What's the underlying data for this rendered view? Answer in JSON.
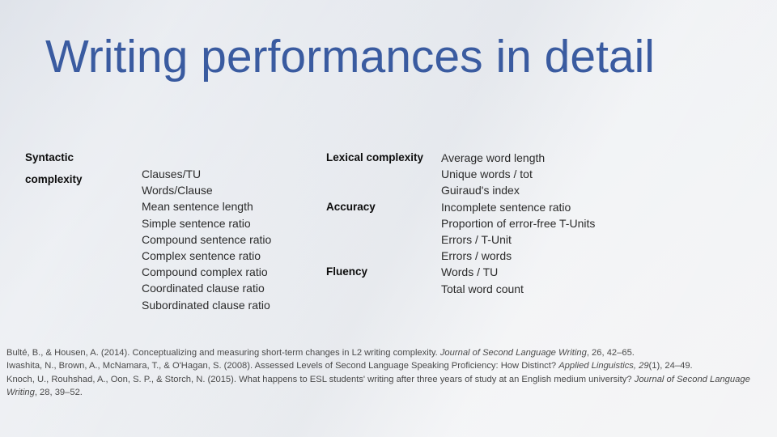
{
  "slide": {
    "title": "Writing performances in detail",
    "title_color": "#3a5ba0",
    "background_color": "#eef0f3"
  },
  "table": {
    "left": {
      "category_line1": "Syntactic",
      "category_line2": "complexity",
      "items": [
        "Clauses/TU",
        "Words/Clause",
        "Mean sentence length",
        "Simple sentence ratio",
        "Compound sentence ratio",
        "Complex sentence ratio",
        "Compound complex ratio",
        "Coordinated clause ratio",
        "Subordinated clause ratio"
      ]
    },
    "right": {
      "categories": [
        {
          "label": "Lexical complexity",
          "row": 0
        },
        {
          "label": "Accuracy",
          "row": 3
        },
        {
          "label": "Fluency",
          "row": 7
        }
      ],
      "items": [
        "Average word length",
        "Unique words / tot",
        "Guiraud's index",
        "Incomplete sentence ratio",
        "Proportion of error-free T-Units",
        "Errors / T-Unit",
        "Errors / words",
        "Words / TU",
        "Total word count"
      ]
    }
  },
  "references": [
    {
      "parts": [
        {
          "text": "Bulté, B., & Housen, A. (2014). Conceptualizing and measuring short-term changes in L2 writing complexity. ",
          "style": "normal"
        },
        {
          "text": "Journal of Second Language Writing",
          "style": "italic"
        },
        {
          "text": ", 26, 42–65.",
          "style": "normal"
        }
      ]
    },
    {
      "parts": [
        {
          "text": "Iwashita, N., Brown, A., McNamara, T., & O'Hagan, S. (2008). Assessed Levels of Second Language Speaking Proficiency: How Distinct? ",
          "style": "normal"
        },
        {
          "text": "Applied Linguistics, 29",
          "style": "italic"
        },
        {
          "text": "(1), 24–49.",
          "style": "normal"
        }
      ]
    },
    {
      "parts": [
        {
          "text": "Knoch, U., Rouhshad, A., Oon, S. P., & Storch, N. (2015). What happens to ESL students' writing after three years of study at an English medium university? ",
          "style": "normal"
        },
        {
          "text": "Journal of Second Language Writing",
          "style": "italic"
        },
        {
          "text": ", 28, 39–52.",
          "style": "normal"
        }
      ]
    }
  ]
}
